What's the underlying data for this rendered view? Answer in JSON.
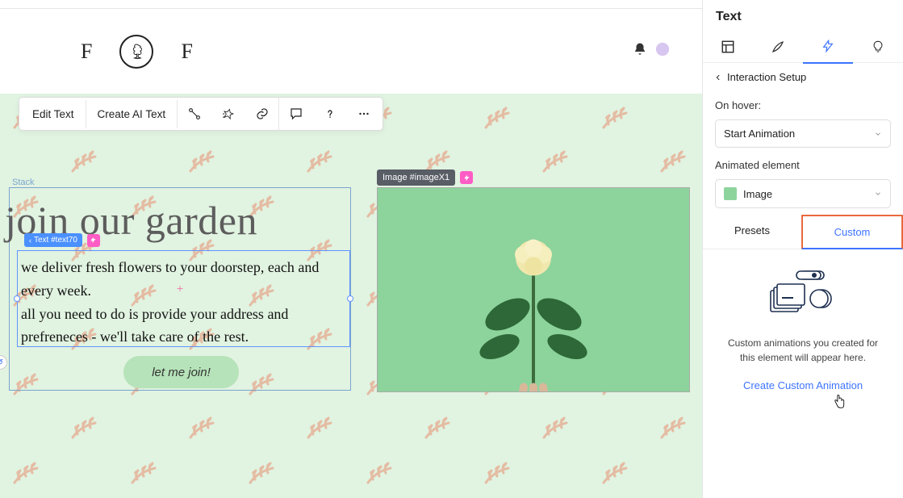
{
  "header": {
    "brand_left": "F",
    "brand_right": "F"
  },
  "toolbar": {
    "edit_text": "Edit Text",
    "create_ai_text": "Create AI Text"
  },
  "canvas": {
    "stack_label": "Stack",
    "heading": "join our garden",
    "text_para1": "we deliver fresh flowers to your doorstep, each and every week.",
    "text_para2": "all you need to do is provide your address and prefreneces - we'll take care of the rest.",
    "cta": "let me join!",
    "text_chip": "Text #text70",
    "image_chip": "Image #imageX1"
  },
  "panel": {
    "title": "Text",
    "breadcrumb": "Interaction Setup",
    "on_hover_label": "On hover:",
    "trigger_value": "Start Animation",
    "anim_el_label": "Animated element",
    "anim_el_value": "Image",
    "tab_presets": "Presets",
    "tab_custom": "Custom",
    "empty_msg": "Custom animations you created for this element will appear here.",
    "create_link": "Create Custom Animation"
  }
}
